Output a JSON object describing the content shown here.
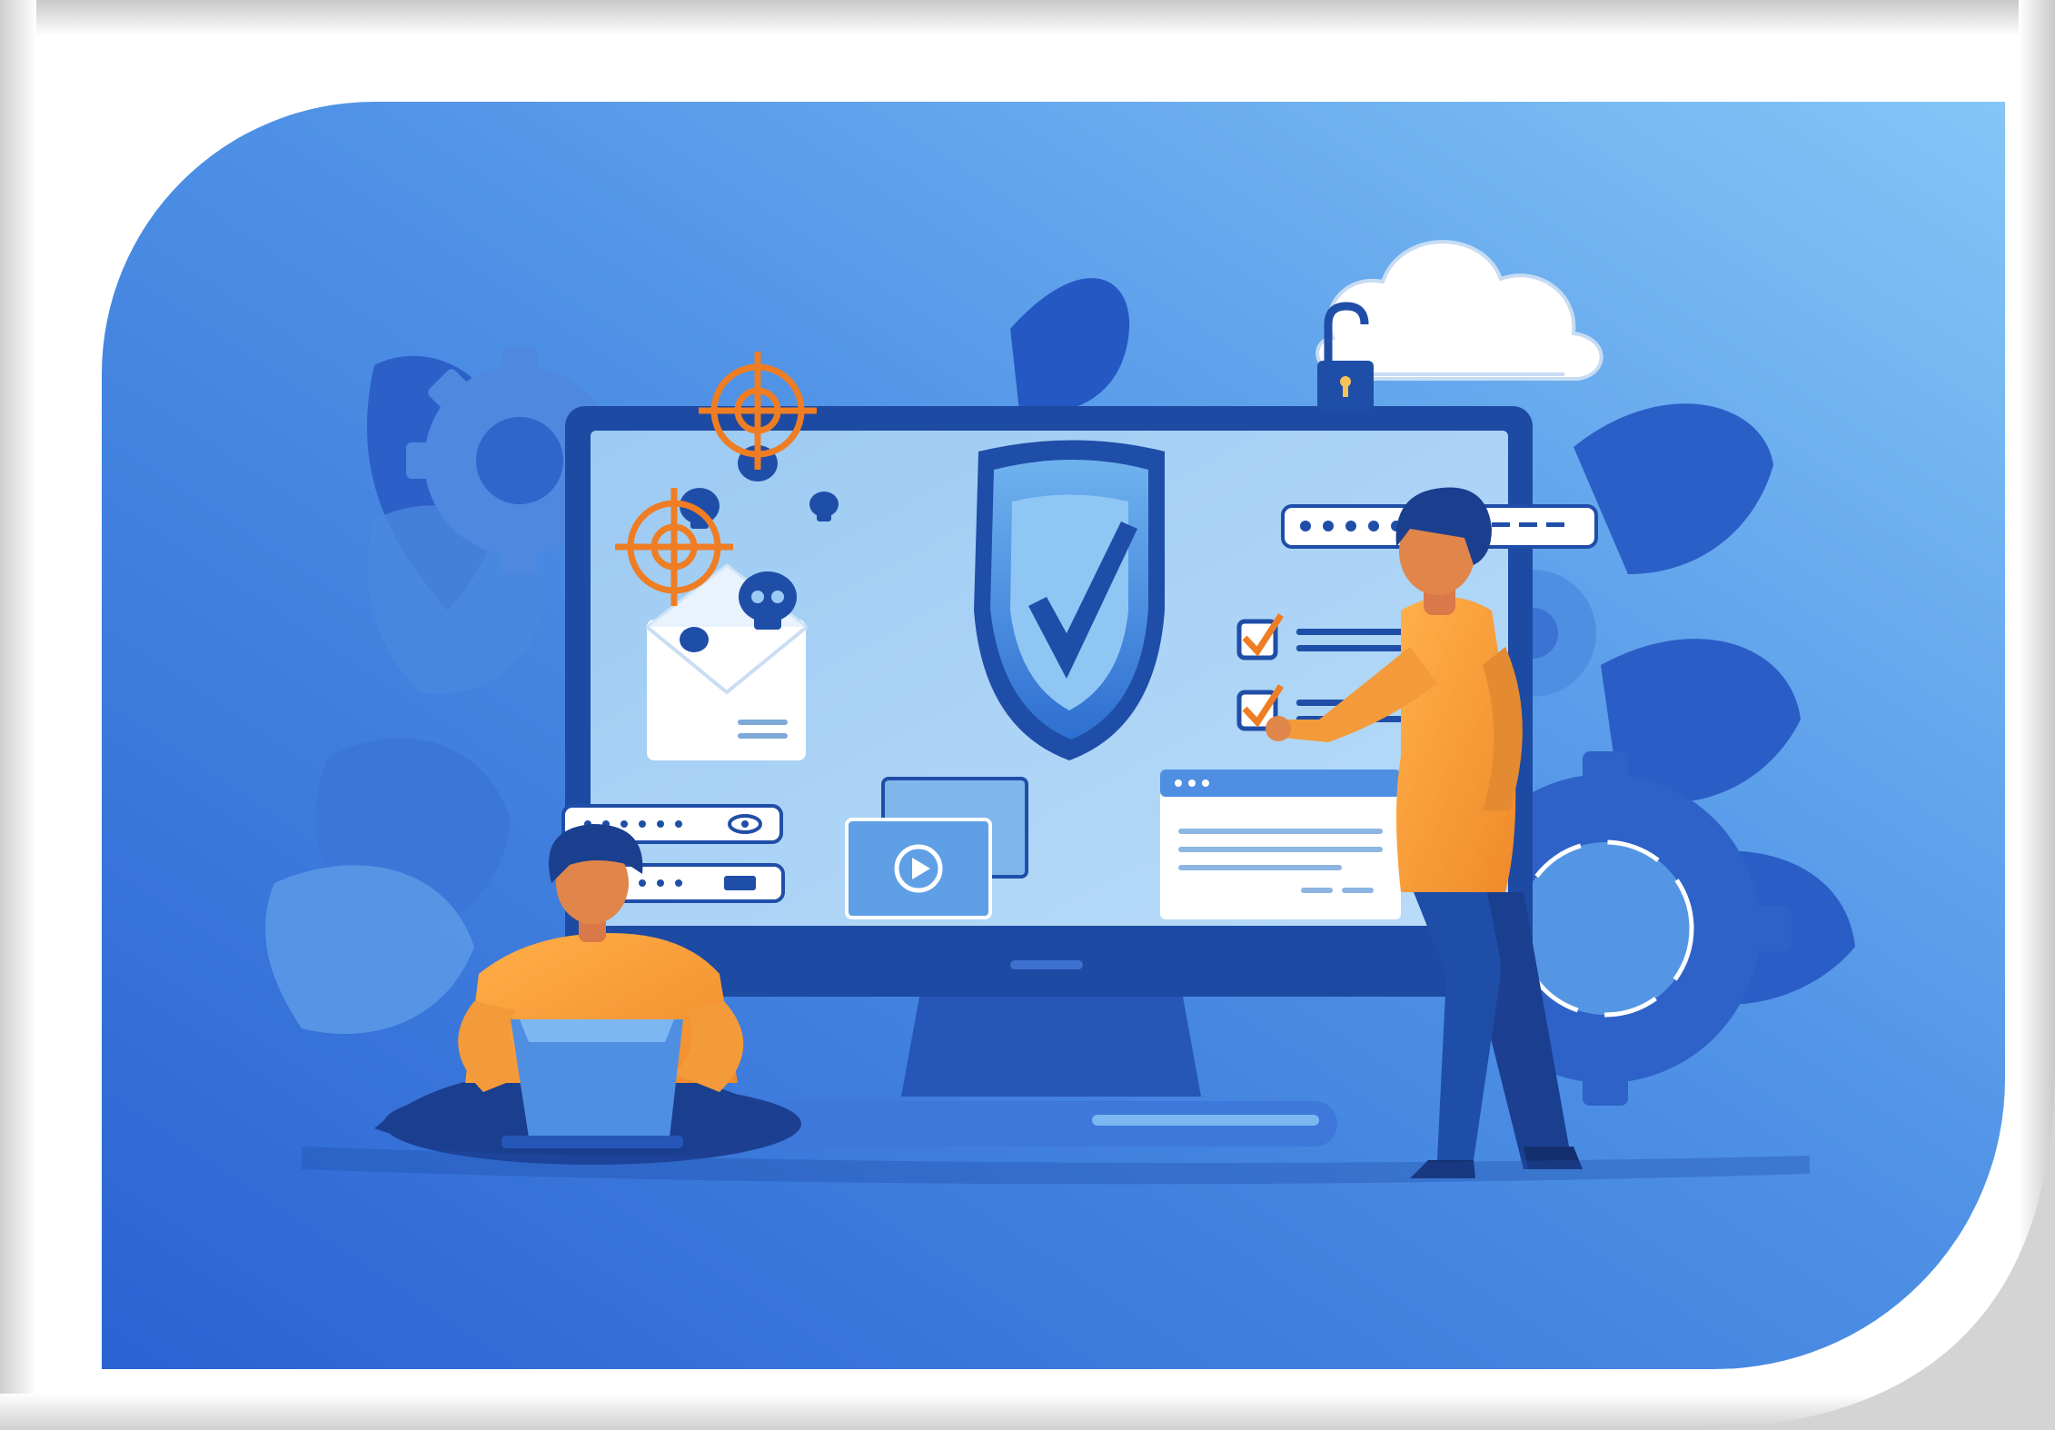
{
  "image": {
    "subject": "cybersecurity-illustration",
    "elements": [
      "shield-check-icon",
      "monitor",
      "cloud-icon",
      "padlock-icon",
      "target-icon",
      "skull-icon",
      "envelope-icon",
      "password-field",
      "checklist",
      "video-window",
      "browser-window",
      "gear-icon",
      "person-standing",
      "person-sitting-with-laptop"
    ],
    "colors": {
      "background_start": "#2a6ad6",
      "background_end": "#7dbff5",
      "accent_orange": "#f39a3a",
      "target_orange": "#ef7d23",
      "dark_navy": "#1a3f8f",
      "screen": "#a9d2f7",
      "frame_white": "#ffffff"
    }
  }
}
